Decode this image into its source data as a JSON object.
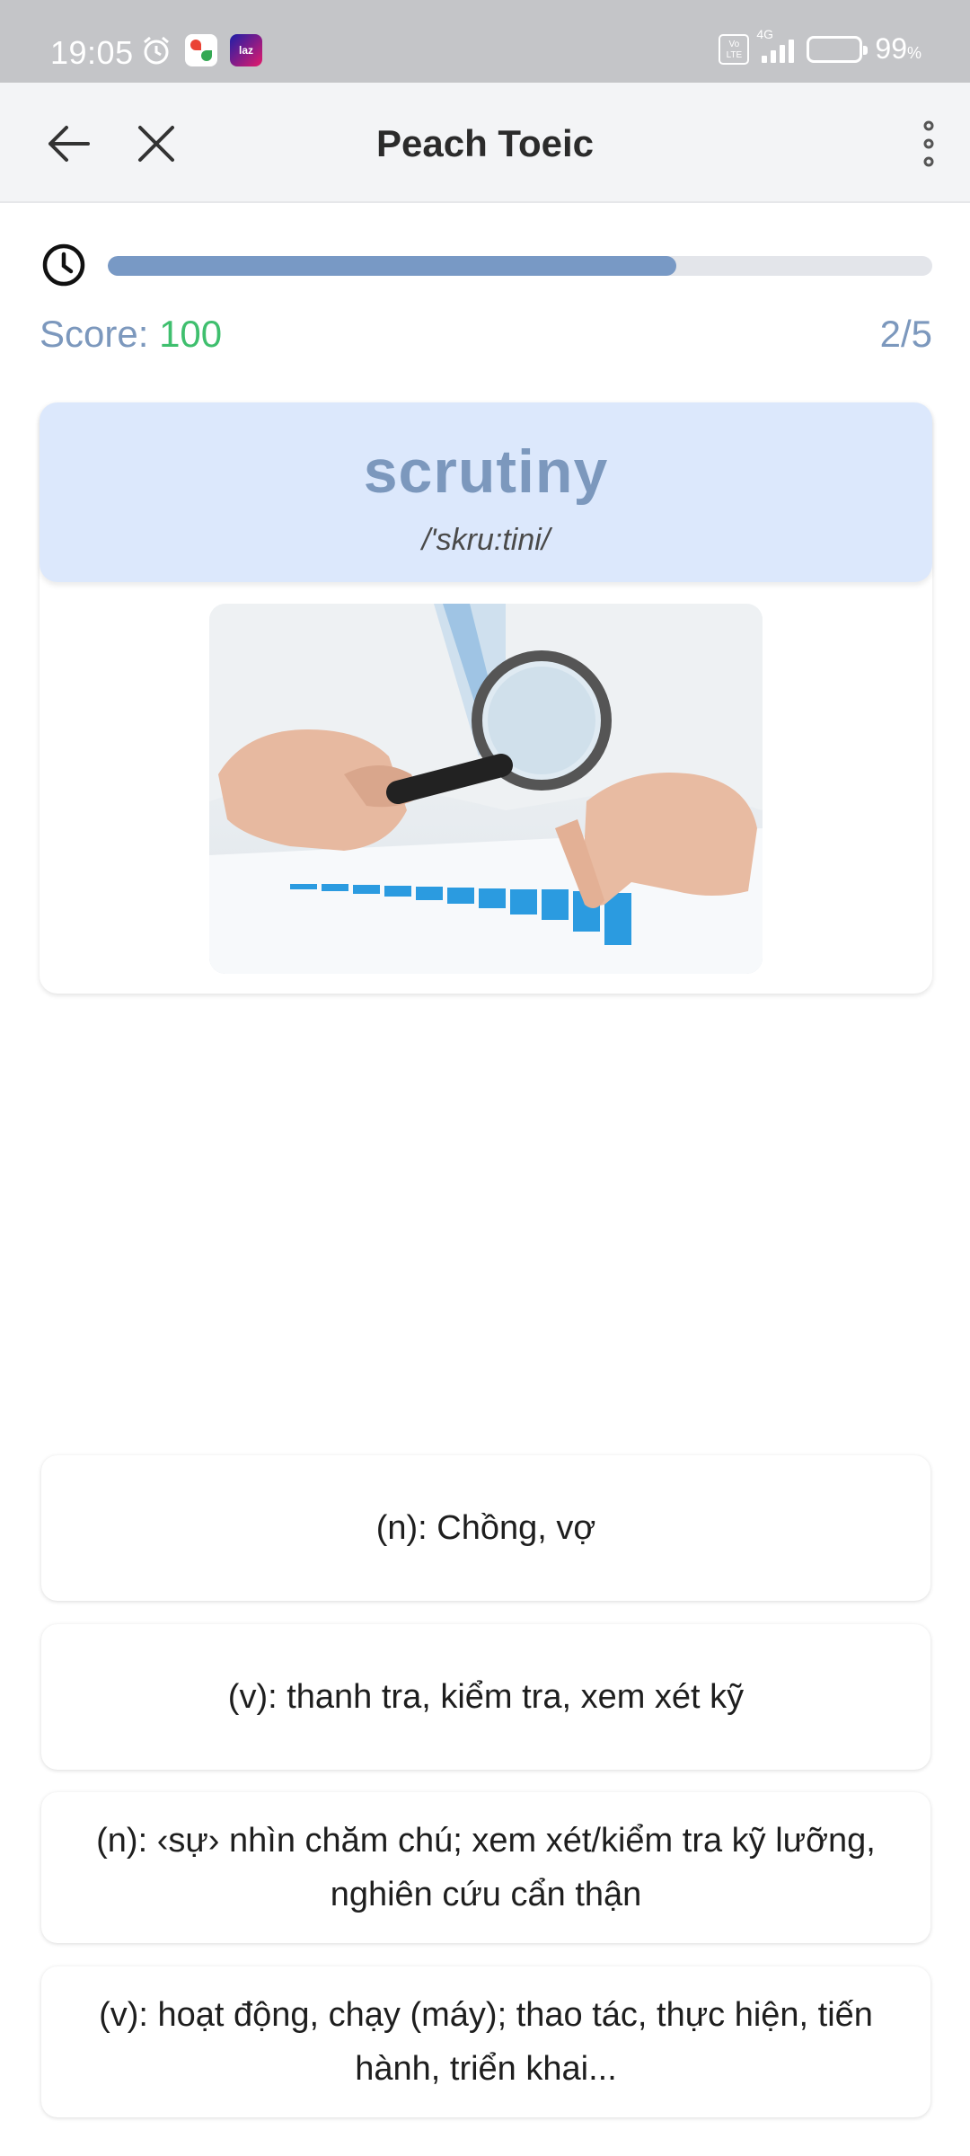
{
  "status_bar": {
    "time": "19:05",
    "network": "4G",
    "volte": "Vo LTE",
    "battery_percent": "99",
    "battery_unit": "%",
    "icons": [
      "alarm-icon",
      "photos-app-icon",
      "lazada-app-icon",
      "volte-icon",
      "signal-icon",
      "battery-icon"
    ]
  },
  "app_bar": {
    "title": "Peach Toeic",
    "back_icon": "arrow-left-icon",
    "close_icon": "close-icon",
    "more_icon": "more-vert-icon"
  },
  "quiz": {
    "progress_fraction": 0.69,
    "score_label": "Score: ",
    "score_value": "100",
    "question_counter": "2/5"
  },
  "word_card": {
    "word": "scrutiny",
    "phonetic": "/'skru:tini/"
  },
  "options": [
    {
      "label": "(n): Chồng, vợ"
    },
    {
      "label": "(v): thanh tra, kiểm tra, xem xét kỹ"
    },
    {
      "label": "(n): ‹sự› nhìn chăm chú; xem xét/kiểm tra kỹ lưỡng, nghiên cứu cẩn thận"
    },
    {
      "label": "(v): hoạt động, chạy (máy); thao tác, thực hiện, tiến hành, triển khai..."
    }
  ],
  "colors": {
    "accent": "#7899c5",
    "score_green": "#3fbf6e",
    "card_header": "#dce8fc"
  }
}
